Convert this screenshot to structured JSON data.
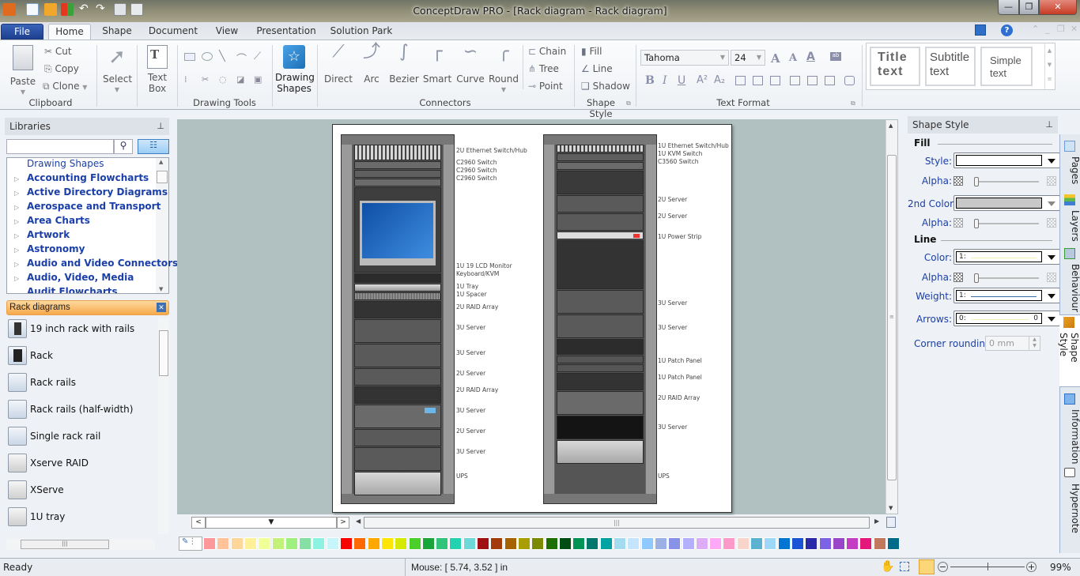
{
  "window": {
    "title": "ConceptDraw PRO - [Rack diagram - Rack diagram]",
    "controls": [
      "minimize",
      "restore",
      "close"
    ]
  },
  "ribbon_tabs": [
    {
      "label": "File",
      "active": false
    },
    {
      "label": "Home",
      "active": true
    },
    {
      "label": "Shape",
      "active": false
    },
    {
      "label": "Document",
      "active": false
    },
    {
      "label": "View",
      "active": false
    },
    {
      "label": "Presentation",
      "active": false
    },
    {
      "label": "Solution Park",
      "active": false
    }
  ],
  "ribbon": {
    "clipboard": {
      "label": "Clipboard",
      "paste": "Paste",
      "cut": "Cut",
      "copy": "Copy",
      "clone": "Clone"
    },
    "select": {
      "label": "Select"
    },
    "textbox": {
      "label1": "Text",
      "label2": "Box"
    },
    "drawing_tools": {
      "label": "Drawing Tools"
    },
    "drawing_shapes": {
      "label1": "Drawing",
      "label2": "Shapes"
    },
    "connectors": {
      "label": "Connectors",
      "items": [
        "Direct",
        "Arc",
        "Bezier",
        "Smart",
        "Curve",
        "Round"
      ],
      "chain": "Chain",
      "tree": "Tree",
      "point": "Point"
    },
    "shape_style": {
      "label": "Shape Style",
      "fill": "Fill",
      "line": "Line",
      "shadow": "Shadow"
    },
    "text_format": {
      "label": "Text Format",
      "font": "Tahoma",
      "size": "24"
    },
    "text_styles": [
      {
        "line1": "Title",
        "line2": "text"
      },
      {
        "line1": "Subtitle",
        "line2": "text"
      },
      {
        "line1": "Simple",
        "line2": "text"
      }
    ]
  },
  "libraries": {
    "title": "Libraries",
    "search_placeholder": "",
    "tree": [
      "Drawing Shapes",
      "Accounting Flowcharts",
      "Active Directory Diagrams",
      "Aerospace and Transport",
      "Area Charts",
      "Artwork",
      "Astronomy",
      "Audio and Video Connectors",
      "Audio, Video, Media",
      "Audit Flowcharts"
    ],
    "open_library": "Rack diagrams",
    "shapes": [
      "19 inch rack with rails",
      "Rack",
      "Rack rails",
      "Rack rails (half-width)",
      "Single rack rail",
      "Xserve RAID",
      "XServe",
      "1U tray"
    ]
  },
  "diagram": {
    "rack_left_labels": [
      "2U Ethernet Switch/Hub",
      "C2960 Switch",
      "C2960 Switch",
      "C2960 Switch",
      "1U 19 LCD Monitor",
      "Keyboard/KVM",
      "1U Tray",
      "1U Spacer",
      "2U RAID Array",
      "3U Server",
      "3U Server",
      "2U Server",
      "2U RAID Array",
      "3U Server",
      "2U Server",
      "3U Server",
      "UPS"
    ],
    "rack_right_labels": [
      "1U Ethernet Switch/Hub",
      "1U KVM Switch",
      "C3560 Switch",
      "2U Server",
      "2U Server",
      "1U Power Strip",
      "3U Server",
      "3U Server",
      "1U Patch Panel",
      "1U Patch Panel",
      "2U RAID Array",
      "3U Server",
      "UPS"
    ]
  },
  "palette": {
    "colors": [
      "#ff9999",
      "#ffc299",
      "#ffd699",
      "#fff199",
      "#f1ff99",
      "#c2f27a",
      "#9ef07f",
      "#86e0a3",
      "#8df2e0",
      "#c6f6fb",
      "#ff0000",
      "#ff6a00",
      "#ffa800",
      "#ffe600",
      "#d4ea00",
      "#4ccf2b",
      "#1aa53a",
      "#2fc47a",
      "#22d2b0",
      "#6ed8d8",
      "#a00f12",
      "#a23c0a",
      "#a46300",
      "#a89e00",
      "#7b8a00",
      "#1d6f00",
      "#004d14",
      "#009356",
      "#00786b",
      "#00a3a3",
      "#a3dbef",
      "#c5e5ff",
      "#8ec9ff",
      "#9bb0e5",
      "#8893e6",
      "#b5b0fd",
      "#dcacf5",
      "#ffa8f7",
      "#ff9ac8",
      "#f9d4ca",
      "#5eb2d1",
      "#9ed7f8",
      "#0075d2",
      "#1b53d6",
      "#2a2aa8",
      "#7d62e6",
      "#9a46c9",
      "#c33ec2",
      "#e3187a",
      "#c2785d",
      "#006c8a"
    ]
  },
  "shape_style_panel": {
    "title": "Shape Style",
    "fill_section": "Fill",
    "style_label": "Style:",
    "style_value": "#ffffff",
    "alpha_label": "Alpha:",
    "second_color_label": "2nd Color:",
    "second_color_value": "#c8c8c8",
    "line_section": "Line",
    "color_label": "Color:",
    "color_value": "1:",
    "weight_label": "Weight:",
    "weight_value": "1:",
    "arrows_label": "Arrows:",
    "arrows_value": "0:",
    "arrows_end": "0",
    "corner_label": "Corner rounding:",
    "corner_value": "0 mm",
    "fill_alpha": 0,
    "second_alpha": 0,
    "line_alpha": 0
  },
  "side_tabs": [
    "Pages",
    "Layers",
    "Behaviour",
    "Shape Style",
    "Information",
    "Hypernote"
  ],
  "status": {
    "ready": "Ready",
    "mouse": "Mouse: [ 5.74, 3.52 ] in",
    "zoom": "99%"
  }
}
